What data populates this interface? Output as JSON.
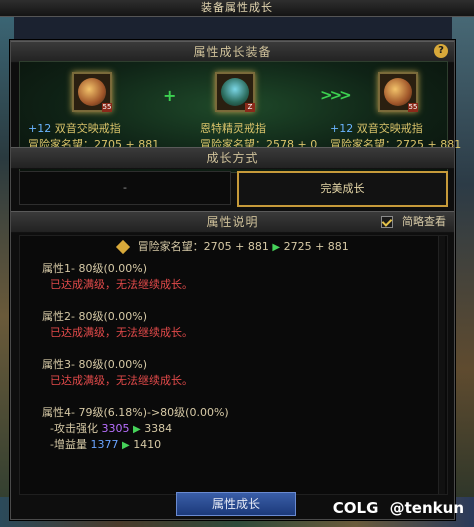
{
  "window": {
    "title": "装备属性成长"
  },
  "sections": {
    "equip": "属性成长装备",
    "method": "成长方式",
    "attributes": "属性说明"
  },
  "equip": {
    "left": {
      "plus": "+12",
      "name": "双音交映戒指",
      "stat": "冒险家名望：2705 + 881",
      "badge": "55"
    },
    "mid": {
      "name": "恩特精灵戒指",
      "stat": "冒险家名望：2578 + 0",
      "badge": "Z"
    },
    "right": {
      "plus": "+12",
      "name": "双音交映戒指",
      "stat": "冒险家名望：2725 + 881",
      "badge": "55"
    }
  },
  "method": {
    "left_label": "-",
    "right_label": "完美成长"
  },
  "brief_toggle": {
    "label": "简略查看",
    "checked": true
  },
  "summary": {
    "label": "冒险家名望：2705 + 881",
    "arrow": "▶",
    "result": "2725 + 881"
  },
  "attributes": [
    {
      "title": "属性1- 80级(0.00%)",
      "note": "已达成满级，无法继续成长。"
    },
    {
      "title": "属性2- 80级(0.00%)",
      "note": "已达成满级，无法继续成长。"
    },
    {
      "title": "属性3- 80级(0.00%)",
      "note": "已达成满级，无法继续成长。"
    },
    {
      "title": "属性4- 79级(6.18%)->80级(0.00%)"
    }
  ],
  "attr4_details": {
    "line1_label": "-攻击强化",
    "line1_from": "3305",
    "line1_to": "3384",
    "line2_label": "-增益量",
    "line2_from": "1377",
    "line2_to": "1410"
  },
  "grow_button": "属性成长",
  "watermark": {
    "logo": "COLG",
    "user": "@tenkun"
  },
  "colors": {
    "accent_gold": "#c69a3a",
    "warn_red": "#e24a4a",
    "green": "#46d35a"
  }
}
